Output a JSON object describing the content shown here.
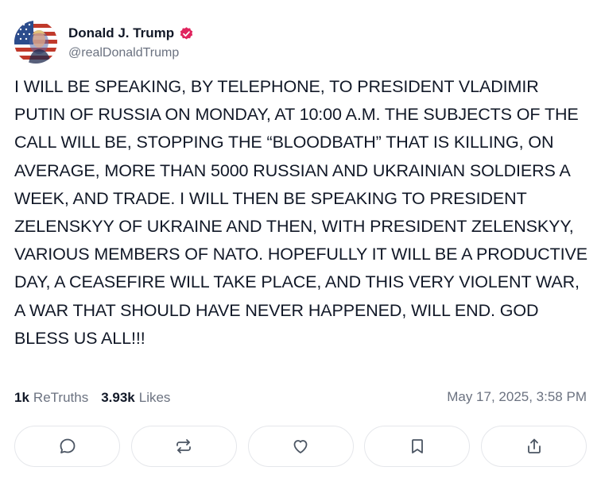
{
  "author": {
    "display_name": "Donald J. Trump",
    "handle": "@realDonaldTrump",
    "verified": true,
    "avatar_icon": "avatar-flag-portrait",
    "verified_color": "#e0245e"
  },
  "post": {
    "text": "I WILL BE SPEAKING, BY TELEPHONE, TO PRESIDENT VLADIMIR PUTIN OF RUSSIA ON MONDAY, AT 10:00 A.M. THE SUBJECTS OF THE CALL WILL BE, STOPPING THE “BLOODBATH” THAT IS KILLING, ON AVERAGE, MORE THAN 5000 RUSSIAN AND UKRAINIAN SOLDIERS A WEEK, AND TRADE. I WILL THEN BE SPEAKING TO PRESIDENT ZELENSKYY OF UKRAINE AND THEN, WITH PRESIDENT ZELENSKYY, VARIOUS MEMBERS OF NATO. HOPEFULLY IT WILL BE A PRODUCTIVE DAY, A CEASEFIRE WILL TAKE PLACE, AND THIS VERY VIOLENT WAR, A WAR THAT SHOULD HAVE NEVER HAPPENED, WILL END. GOD BLESS US ALL!!!"
  },
  "stats": {
    "retruths_count": "1k",
    "retruths_label": "ReTruths",
    "likes_count": "3.93k",
    "likes_label": "Likes",
    "timestamp": "May 17, 2025, 3:58 PM"
  },
  "actions": [
    {
      "icon": "reply-icon"
    },
    {
      "icon": "retruth-icon"
    },
    {
      "icon": "like-icon"
    },
    {
      "icon": "bookmark-icon"
    },
    {
      "icon": "share-icon"
    }
  ],
  "colors": {
    "text": "#111827",
    "muted": "#6b7280",
    "border": "#e5e7eb",
    "icon": "#4b5563"
  }
}
